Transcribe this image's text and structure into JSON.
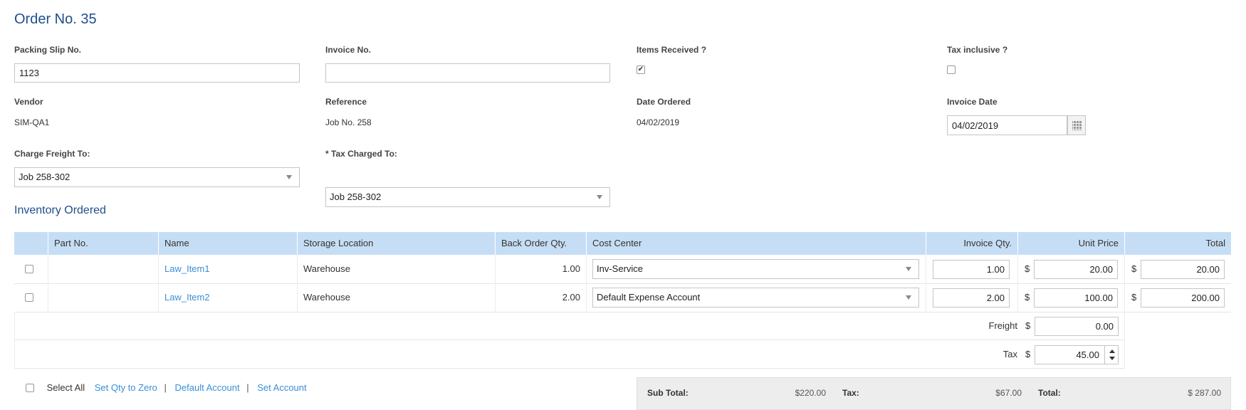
{
  "page_title": "Order No. 35",
  "form": {
    "packing_slip": {
      "label": "Packing Slip No.",
      "value": "1123"
    },
    "invoice_no": {
      "label": "Invoice No.",
      "value": ""
    },
    "items_received": {
      "label": "Items Received ?",
      "checked": true
    },
    "tax_inclusive": {
      "label": "Tax inclusive ?",
      "checked": false
    },
    "vendor": {
      "label": "Vendor",
      "value": "SIM-QA1"
    },
    "reference": {
      "label": "Reference",
      "value": "Job No. 258"
    },
    "date_ordered": {
      "label": "Date Ordered",
      "value": "04/02/2019"
    },
    "invoice_date": {
      "label": "Invoice Date",
      "value": "04/02/2019"
    },
    "charge_freight_to": {
      "label": "Charge Freight To:",
      "value": "Job 258-302"
    },
    "tax_charged_to": {
      "label": "* Tax Charged To:",
      "value": "Job 258-302"
    }
  },
  "inventory": {
    "title": "Inventory Ordered",
    "columns": [
      "Part No.",
      "Name",
      "Storage Location",
      "Back Order Qty.",
      "Cost Center",
      "Invoice Qty.",
      "Unit Price",
      "Total"
    ],
    "rows": [
      {
        "part_no": "",
        "name": "Law_Item1",
        "storage": "Warehouse",
        "back_order": "1.00",
        "cost_center": "Inv-Service",
        "invoice_qty": "1.00",
        "unit_price": "20.00",
        "total": "20.00"
      },
      {
        "part_no": "",
        "name": "Law_Item2",
        "storage": "Warehouse",
        "back_order": "2.00",
        "cost_center": "Default Expense Account",
        "invoice_qty": "2.00",
        "unit_price": "100.00",
        "total": "200.00"
      }
    ],
    "freight": {
      "label": "Freight",
      "value": "0.00"
    },
    "tax": {
      "label": "Tax",
      "value": "45.00"
    },
    "currency": "$"
  },
  "footer": {
    "select_all": "Select All",
    "set_qty_zero": "Set Qty to Zero",
    "default_account": "Default Account",
    "set_account": "Set Account",
    "separator": "|"
  },
  "totals": {
    "sub_total_label": "Sub Total:",
    "sub_total": "$220.00",
    "tax_label": "Tax:",
    "tax": "$67.00",
    "total_label": "Total:",
    "total": "$ 287.00"
  }
}
